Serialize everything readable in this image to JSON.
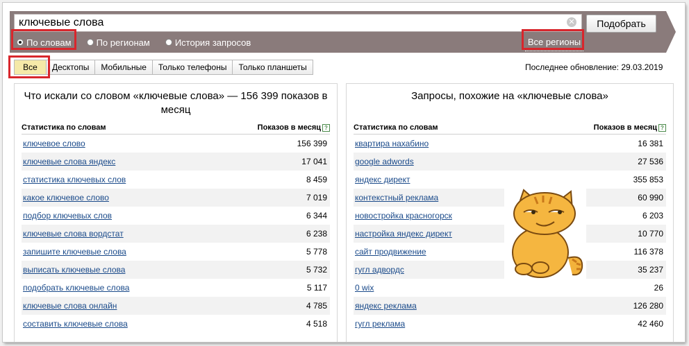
{
  "search": {
    "query": "ключевые слова",
    "submit_label": "Подобрать"
  },
  "modes": [
    {
      "label": "По словам",
      "selected": true
    },
    {
      "label": "По регионам",
      "selected": false
    },
    {
      "label": "История запросов",
      "selected": false
    }
  ],
  "regions_label": "Все регионы",
  "device_tabs": [
    "Все",
    "Десктопы",
    "Мобильные",
    "Только телефоны",
    "Только планшеты"
  ],
  "updated": "Последнее обновление: 29.03.2019",
  "left_panel": {
    "title": "Что искали со словом «ключевые слова» — 156 399 показов в месяц",
    "col_keyword": "Статистика по словам",
    "col_shows": "Показов в месяц",
    "rows": [
      {
        "kw": "ключевое слово",
        "n": "156 399"
      },
      {
        "kw": "ключевые слова яндекс",
        "n": "17 041"
      },
      {
        "kw": "статистика ключевых слов",
        "n": "8 459"
      },
      {
        "kw": "какое ключевое слово",
        "n": "7 019"
      },
      {
        "kw": "подбор ключевых слов",
        "n": "6 344"
      },
      {
        "kw": "ключевые слова вордстат",
        "n": "6 238"
      },
      {
        "kw": "запишите ключевые слова",
        "n": "5 778"
      },
      {
        "kw": "выписать ключевые слова",
        "n": "5 732"
      },
      {
        "kw": "подобрать ключевые слова",
        "n": "5 117"
      },
      {
        "kw": "ключевые слова онлайн",
        "n": "4 785"
      },
      {
        "kw": "составить ключевые слова",
        "n": "4 518"
      }
    ]
  },
  "right_panel": {
    "title": "Запросы, похожие на «ключевые слова»",
    "col_keyword": "Статистика по словам",
    "col_shows": "Показов в месяц",
    "rows": [
      {
        "kw": "квартира нахабино",
        "n": "16 381"
      },
      {
        "kw": "google adwords",
        "n": "27 536"
      },
      {
        "kw": "яндекс директ",
        "n": "355 853"
      },
      {
        "kw": "контекстный реклама",
        "n": "60 990"
      },
      {
        "kw": "новостройка красногорск",
        "n": "6 203"
      },
      {
        "kw": "настройка яндекс директ",
        "n": "10 770"
      },
      {
        "kw": "сайт продвижение",
        "n": "116 378"
      },
      {
        "kw": "гугл адвордс",
        "n": "35 237"
      },
      {
        "kw": "0 wix",
        "n": "26"
      },
      {
        "kw": "яндекс реклама",
        "n": "126 280"
      },
      {
        "kw": "гугл реклама",
        "n": "42 460"
      }
    ]
  },
  "colors": {
    "bar": "#8a7b7b",
    "highlight": "#d8262c",
    "link": "#1a4a8a",
    "active_tab": "#f5e9a8"
  },
  "icons": {
    "clear": "clear-icon",
    "help": "help-icon",
    "sticker": "cat-sticker"
  }
}
